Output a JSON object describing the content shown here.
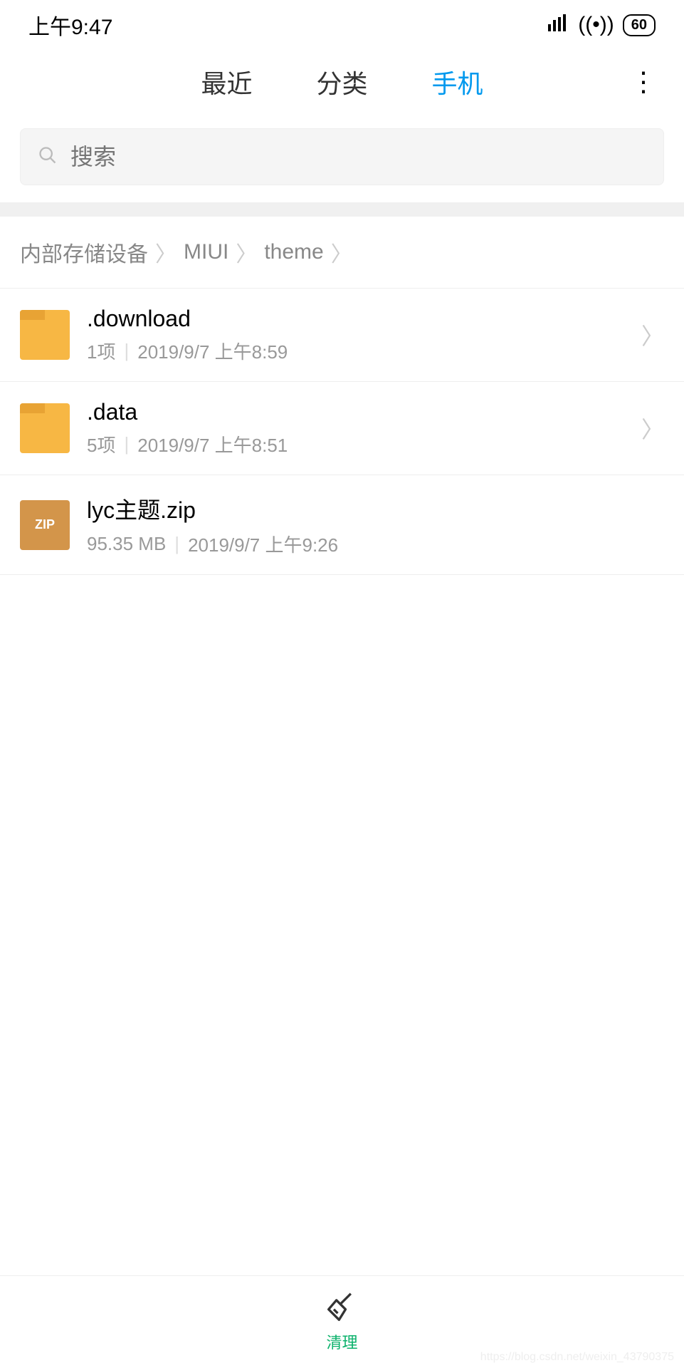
{
  "status": {
    "time": "上午9:47",
    "battery": "60"
  },
  "tabs": {
    "recent": "最近",
    "category": "分类",
    "phone": "手机"
  },
  "search": {
    "placeholder": "搜索"
  },
  "breadcrumb": {
    "items": [
      "内部存储设备",
      "MIUI",
      "theme"
    ]
  },
  "files": [
    {
      "type": "folder",
      "name": ".download",
      "count": "1项",
      "time": "2019/9/7 上午8:59"
    },
    {
      "type": "folder",
      "name": ".data",
      "count": "5项",
      "time": "2019/9/7 上午8:51"
    },
    {
      "type": "zip",
      "name": "lyc主题.zip",
      "size": "95.35 MB",
      "time": "2019/9/7 上午9:26",
      "badge": "ZIP"
    }
  ],
  "bottom": {
    "clean": "清理"
  },
  "watermark": "https://blog.csdn.net/weixin_43790375"
}
